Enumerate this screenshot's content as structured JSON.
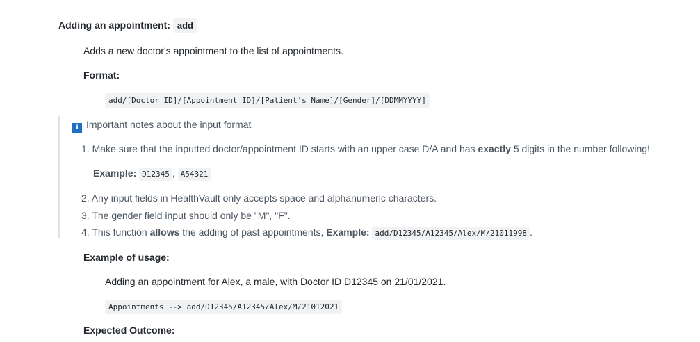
{
  "section": {
    "heading": "Adding an appointment:",
    "command": "add",
    "description": "Adds a new doctor's appointment to the list of appointments.",
    "format_label": "Format:",
    "format_code": "add/[Doctor ID]/[Appointment ID]/[Patient’s Name]/[Gender]/[DDMMYYYY]"
  },
  "note": {
    "icon": "info-icon",
    "title": "Important notes about the input format",
    "item1_prefix": "1. Make sure that the inputted doctor/appointment ID starts with an upper case D/A and has ",
    "item1_bold": "exactly",
    "item1_suffix": " 5 digits in the number following!",
    "example_label": "Example:",
    "example_code1": "D12345",
    "example_sep": ",",
    "example_code2": "A54321",
    "item2": "2. Any input fields in HealthVault only accepts space and alphanumeric characters.",
    "item3": "3. The gender field input should only be \"M\", \"F\".",
    "item4_prefix": "4. This function ",
    "item4_bold": "allows",
    "item4_middle": " the adding of past appointments, ",
    "item4_example_label": "Example:",
    "item4_code": "add/D12345/A12345/Alex/M/21011998",
    "item4_end": "."
  },
  "usage": {
    "label": "Example of usage:",
    "description": "Adding an appointment for Alex, a male, with Doctor ID D12345 on 21/01/2021.",
    "code": "Appointments --> add/D12345/A12345/Alex/M/21012021"
  },
  "outcome": {
    "label": "Expected Outcome:"
  }
}
